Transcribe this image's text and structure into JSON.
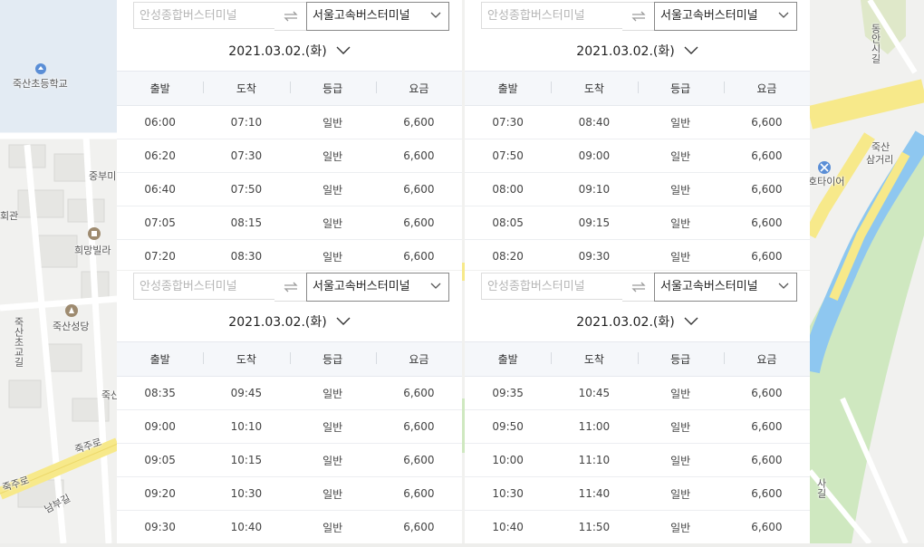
{
  "map": {
    "labels": [
      {
        "id": "school",
        "text": "죽산초등학교"
      },
      {
        "id": "jungbu",
        "text": "중부미"
      },
      {
        "id": "hall",
        "text": "회관"
      },
      {
        "id": "villa",
        "text": "희망빌라"
      },
      {
        "id": "church",
        "text": "죽산성당"
      },
      {
        "id": "jook",
        "text": "죽산"
      },
      {
        "id": "road1",
        "text": "죽주로"
      },
      {
        "id": "road2",
        "text": "죽주로"
      },
      {
        "id": "namgu",
        "text": "남부길"
      },
      {
        "id": "sogyo",
        "text": "죽산초교길"
      },
      {
        "id": "tonggil",
        "text": "동안시길"
      },
      {
        "id": "samgeori1",
        "text": "죽산"
      },
      {
        "id": "samgeori2",
        "text": "삼거리"
      },
      {
        "id": "tire",
        "text": "호타이어"
      },
      {
        "id": "sagil",
        "text": "사길"
      }
    ],
    "colors": {
      "road": "#f7e98a",
      "river": "#8ec7f0",
      "green": "#cfe8c0",
      "bg": "#eeeeec"
    }
  },
  "panels": [
    {
      "from_placeholder": "안성종합버스터미널",
      "to_station": "서울고속버스터미널",
      "date": "2021.03.02.(화)",
      "headers": [
        "출발",
        "도착",
        "등급",
        "요금"
      ],
      "rows": [
        [
          "06:00",
          "07:10",
          "일반",
          "6,600"
        ],
        [
          "06:20",
          "07:30",
          "일반",
          "6,600"
        ],
        [
          "06:40",
          "07:50",
          "일반",
          "6,600"
        ],
        [
          "07:05",
          "08:15",
          "일반",
          "6,600"
        ],
        [
          "07:20",
          "08:30",
          "일반",
          "6,600"
        ]
      ]
    },
    {
      "from_placeholder": "안성종합버스터미널",
      "to_station": "서울고속버스터미널",
      "date": "2021.03.02.(화)",
      "headers": [
        "출발",
        "도착",
        "등급",
        "요금"
      ],
      "rows": [
        [
          "07:30",
          "08:40",
          "일반",
          "6,600"
        ],
        [
          "07:50",
          "09:00",
          "일반",
          "6,600"
        ],
        [
          "08:00",
          "09:10",
          "일반",
          "6,600"
        ],
        [
          "08:05",
          "09:15",
          "일반",
          "6,600"
        ],
        [
          "08:20",
          "09:30",
          "일반",
          "6,600"
        ]
      ]
    },
    {
      "from_placeholder": "안성종합버스터미널",
      "to_station": "서울고속버스터미널",
      "date": "2021.03.02.(화)",
      "headers": [
        "출발",
        "도착",
        "등급",
        "요금"
      ],
      "rows": [
        [
          "08:35",
          "09:45",
          "일반",
          "6,600"
        ],
        [
          "09:00",
          "10:10",
          "일반",
          "6,600"
        ],
        [
          "09:05",
          "10:15",
          "일반",
          "6,600"
        ],
        [
          "09:20",
          "10:30",
          "일반",
          "6,600"
        ],
        [
          "09:30",
          "10:40",
          "일반",
          "6,600"
        ]
      ]
    },
    {
      "from_placeholder": "안성종합버스터미널",
      "to_station": "서울고속버스터미널",
      "date": "2021.03.02.(화)",
      "headers": [
        "출발",
        "도착",
        "등급",
        "요금"
      ],
      "rows": [
        [
          "09:35",
          "10:45",
          "일반",
          "6,600"
        ],
        [
          "09:50",
          "11:00",
          "일반",
          "6,600"
        ],
        [
          "10:00",
          "11:10",
          "일반",
          "6,600"
        ],
        [
          "10:30",
          "11:40",
          "일반",
          "6,600"
        ],
        [
          "10:40",
          "11:50",
          "일반",
          "6,600"
        ]
      ]
    }
  ]
}
